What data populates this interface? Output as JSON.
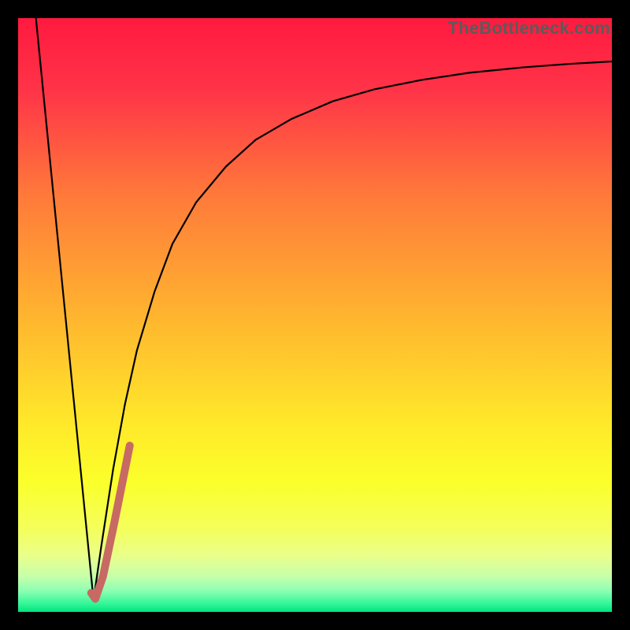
{
  "watermark": "TheBottleneck.com",
  "chart_data": {
    "type": "line",
    "title": "",
    "xlabel": "",
    "ylabel": "",
    "xlim": [
      0,
      100
    ],
    "ylim": [
      0,
      100
    ],
    "grid": false,
    "legend": false,
    "gradient_stops": [
      {
        "offset": 0.0,
        "color": "#ff1a3f"
      },
      {
        "offset": 0.12,
        "color": "#ff3348"
      },
      {
        "offset": 0.3,
        "color": "#ff7a3a"
      },
      {
        "offset": 0.5,
        "color": "#ffb42f"
      },
      {
        "offset": 0.68,
        "color": "#ffe82a"
      },
      {
        "offset": 0.78,
        "color": "#fbff2a"
      },
      {
        "offset": 0.86,
        "color": "#f4ff5b"
      },
      {
        "offset": 0.905,
        "color": "#eaff8a"
      },
      {
        "offset": 0.94,
        "color": "#c7ffab"
      },
      {
        "offset": 0.965,
        "color": "#8bffb2"
      },
      {
        "offset": 0.985,
        "color": "#38f79a"
      },
      {
        "offset": 1.0,
        "color": "#00e57e"
      }
    ],
    "series": [
      {
        "name": "left-descent",
        "color": "#000000",
        "width": 2.2,
        "x": [
          3.0,
          12.7
        ],
        "y": [
          100.0,
          2.0
        ]
      },
      {
        "name": "right-curve",
        "color": "#000000",
        "width": 2.2,
        "x": [
          12.7,
          14,
          16,
          18,
          20,
          23,
          26,
          30,
          35,
          40,
          46,
          53,
          60,
          68,
          76,
          85,
          93,
          100
        ],
        "y": [
          2.0,
          11,
          24,
          35,
          44,
          54,
          62,
          69,
          75,
          79.5,
          83,
          86,
          88,
          89.6,
          90.8,
          91.7,
          92.3,
          92.7
        ]
      },
      {
        "name": "highlight-hook",
        "color": "#c76a63",
        "width": 10,
        "linecap": "round",
        "x": [
          12.3,
          13.0,
          14.3,
          16.2,
          18.8
        ],
        "y": [
          3.2,
          2.2,
          6.0,
          15.0,
          28.0
        ]
      }
    ]
  }
}
